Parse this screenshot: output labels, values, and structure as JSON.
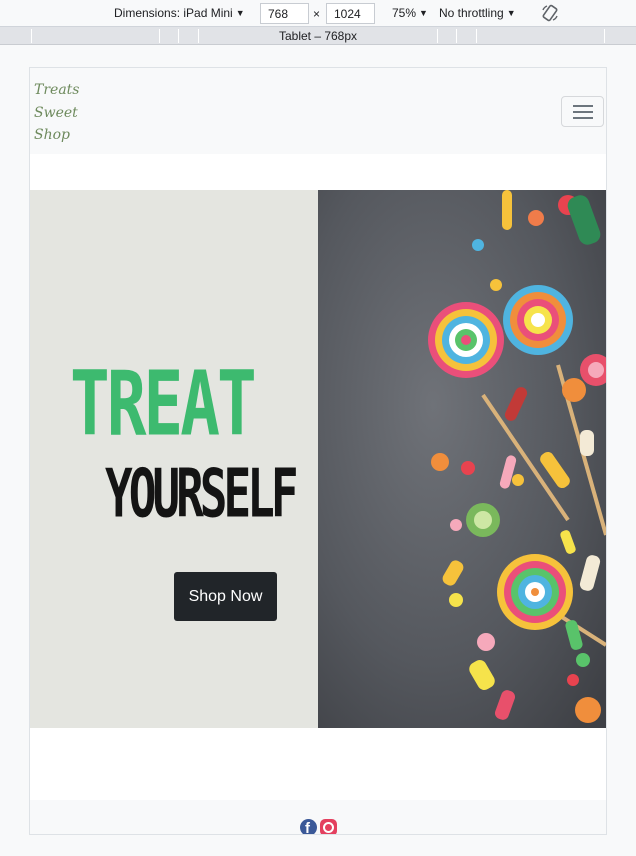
{
  "devtools": {
    "dimensions_label": "Dimensions: iPad Mini",
    "width_value": "768",
    "height_value": "1024",
    "times": "×",
    "zoom": "75%",
    "throttling": "No throttling",
    "ruler_label": "Tablet – 768px"
  },
  "site": {
    "brand_lines": [
      "Treats",
      "Sweet",
      "Shop"
    ],
    "hero": {
      "headline_1": "TREAT",
      "headline_2": "YOURSELF",
      "button": "Shop Now"
    }
  },
  "icons": {
    "menu": "hamburger-menu-icon",
    "facebook": "facebook-icon",
    "instagram": "instagram-icon",
    "rotate": "rotate-icon"
  },
  "colors": {
    "brand_text": "#6e8a5d",
    "headline_green": "#3dba6f",
    "button_bg": "#212529",
    "hero_left_bg": "#e4e5e0",
    "facebook": "#3b5998",
    "instagram": "#e4405f"
  }
}
